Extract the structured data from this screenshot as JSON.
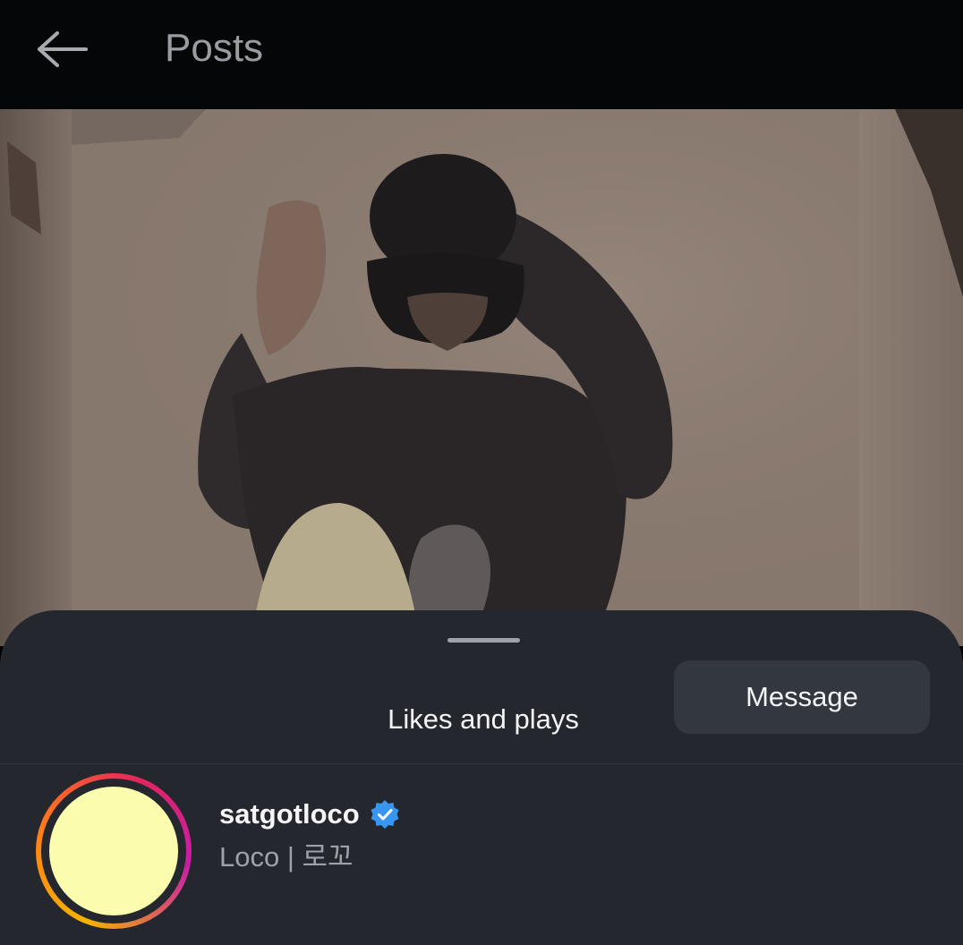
{
  "header": {
    "title": "Posts",
    "back_icon": "arrow-left-icon"
  },
  "media": {
    "description_icon": "video-frame"
  },
  "sheet": {
    "title": "Likes and plays"
  },
  "user": {
    "username": "satgotloco",
    "full_name": "Loco | 로꼬",
    "verified": true,
    "verified_icon": "verified-badge-icon",
    "message_label": "Message"
  },
  "colors": {
    "verified_blue": "#3797f0",
    "avatar_fill": "#fbfcad",
    "sheet_bg": "#24272d",
    "button_bg": "#33373f"
  }
}
